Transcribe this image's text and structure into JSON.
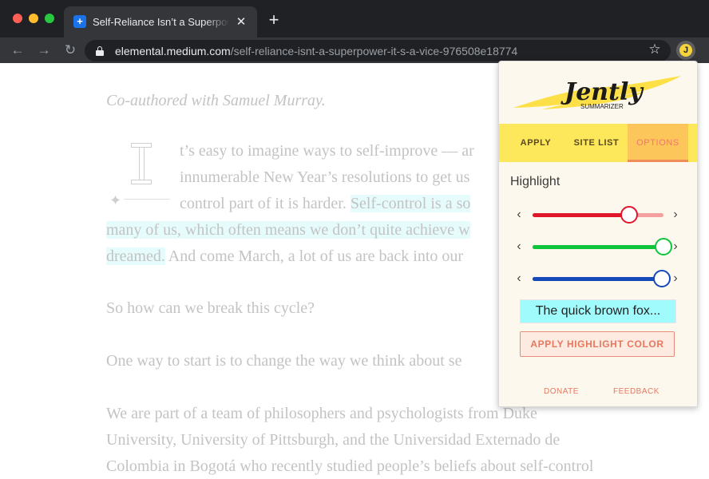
{
  "browser": {
    "tab_title": "Self-Reliance Isn’t a Superpower",
    "tab_close": "✕",
    "new_tab": "+",
    "url_host": "elemental.medium.com",
    "url_path": "/self-reliance-isnt-a-superpower-it-s-a-vice-976508e18774",
    "nav": {
      "back": "←",
      "forward": "→",
      "reload": "↻"
    },
    "star": "☆"
  },
  "article": {
    "coauthor": "Co-authored with Samuel Murray.",
    "p1_line1": "t’s easy to imagine ways to self-improve — ar",
    "p1_line2": "innumerable New Year’s resolutions to get us",
    "p1_line3_plain": "control part of it is harder. ",
    "p1_line3_hl": "Self-control is a so",
    "p1_line4_hl": "many of us, which often means we don’t quite achieve w",
    "p1_line5_hl": "dreamed.",
    "p1_line5_plain": " And come March, a lot of us are back into our",
    "p2": "So how can we break this cycle?",
    "p3": "One way to start is to change the way we think about se",
    "p4_line1": "We are part of a team of philosophers and psychologists from Duke",
    "p4_line2": "University, University of Pittsburgh, and the Universidad Externado de",
    "p4_line3": "Colombia in Bogotá who recently studied people’s beliefs about self-control"
  },
  "popup": {
    "logo_word": "Jently",
    "logo_sub": "SUMMARIZER",
    "tabs": {
      "apply": "APPLY",
      "site_list": "SITE LIST",
      "options": "OPTIONS"
    },
    "section_title": "Highlight",
    "sliders": [
      {
        "name": "red",
        "value": 0.74,
        "color": "#e0162b",
        "rest_color": "#f4a0a0"
      },
      {
        "name": "green",
        "value": 1.0,
        "color": "#0ec53b",
        "rest_color": "#0ec53b"
      },
      {
        "name": "blue",
        "value": 0.99,
        "color": "#1449b8",
        "rest_color": "#1449b8"
      }
    ],
    "chevron_left": "‹",
    "chevron_right": "›",
    "preview_text": "The quick brown fox...",
    "preview_color": "#a0fbfd",
    "apply_color_label": "APPLY HIGHLIGHT COLOR",
    "donate": "DONATE",
    "feedback": "FEEDBACK"
  }
}
